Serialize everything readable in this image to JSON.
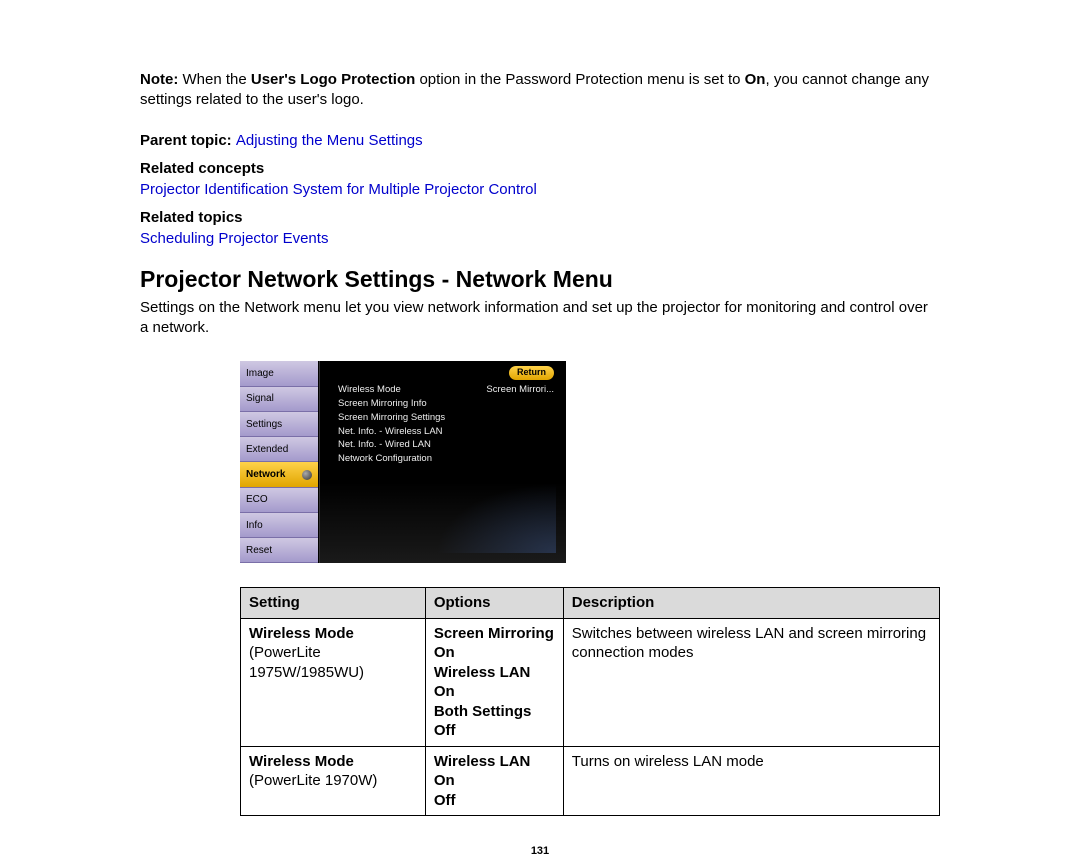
{
  "note": {
    "label": "Note:",
    "part1": " When the ",
    "bold1": "User's Logo Protection",
    "part2": " option in the Password Protection menu is set to ",
    "bold2": "On",
    "part3": ", you cannot change any settings related to the user's logo."
  },
  "parent_topic": {
    "label": "Parent topic: ",
    "link": "Adjusting the Menu Settings"
  },
  "related_concepts": {
    "label": "Related concepts",
    "link": "Projector Identification System for Multiple Projector Control"
  },
  "related_topics": {
    "label": "Related topics",
    "link": "Scheduling Projector Events"
  },
  "section": {
    "heading": "Projector Network Settings - Network Menu",
    "intro": "Settings on the Network menu let you view network information and set up the projector for monitoring and control over a network."
  },
  "osd": {
    "tabs": [
      "Image",
      "Signal",
      "Settings",
      "Extended",
      "Network",
      "ECO",
      "Info",
      "Reset"
    ],
    "selected_tab": "Network",
    "return": "Return",
    "items": [
      {
        "label": "Wireless Mode",
        "value": "Screen Mirrori..."
      },
      {
        "label": "Screen Mirroring Info",
        "value": ""
      },
      {
        "label": "Screen Mirroring Settings",
        "value": ""
      },
      {
        "label": "Net. Info. - Wireless LAN",
        "value": ""
      },
      {
        "label": "Net. Info. - Wired LAN",
        "value": ""
      },
      {
        "label": "Network Configuration",
        "value": ""
      }
    ]
  },
  "table": {
    "headers": [
      "Setting",
      "Options",
      "Description"
    ],
    "rows": [
      {
        "setting": [
          {
            "text": "Wireless Mode",
            "bold": true
          },
          {
            "text": "(PowerLite 1975W/1985WU)",
            "bold": false
          }
        ],
        "options": [
          {
            "text": "Screen Mirroring On",
            "bold": true
          },
          {
            "text": "Wireless LAN On",
            "bold": true
          },
          {
            "text": "Both Settings Off",
            "bold": true
          }
        ],
        "description": [
          {
            "text": "Switches between wireless LAN and screen mirroring connection modes",
            "bold": false
          }
        ]
      },
      {
        "setting": [
          {
            "text": "Wireless Mode",
            "bold": true
          },
          {
            "text": "(PowerLite 1970W)",
            "bold": false
          }
        ],
        "options": [
          {
            "text": "Wireless LAN On",
            "bold": true
          },
          {
            "text": "Off",
            "bold": true
          }
        ],
        "description": [
          {
            "text": "Turns on wireless LAN mode",
            "bold": false
          }
        ]
      }
    ]
  },
  "page_number": "131"
}
